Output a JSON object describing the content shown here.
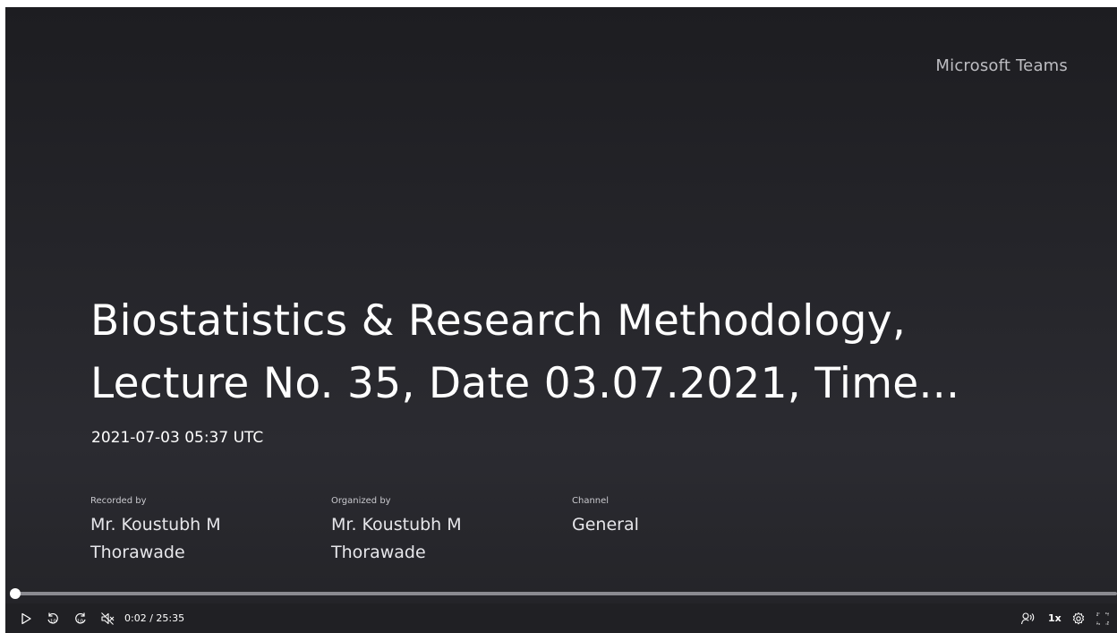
{
  "app": {
    "brand": "Microsoft Teams"
  },
  "recording": {
    "title_line1": "Biostatistics & Research Methodology,",
    "title_line2": "Lecture No. 35, Date 03.07.2021, Time...",
    "timestamp": "2021-07-03 05:37 UTC",
    "recorded_by_label": "Recorded by",
    "recorded_by_value": "Mr. Koustubh M Thorawade",
    "organized_by_label": "Organized by",
    "organized_by_value": "Mr. Koustubh M Thorawade",
    "channel_label": "Channel",
    "channel_value": "General"
  },
  "player": {
    "progress_fraction": 0.0013,
    "time_display": "0:02 / 25:35",
    "speed_label": "1x",
    "colors": {
      "track": "#8a8a90",
      "fill": "#ffffff",
      "bar_bg": "#202024"
    },
    "icons": [
      "play-icon",
      "rewind-10-icon",
      "forward-10-icon",
      "mute-icon",
      "transcript-icon",
      "settings-icon",
      "fullscreen-icon"
    ]
  }
}
